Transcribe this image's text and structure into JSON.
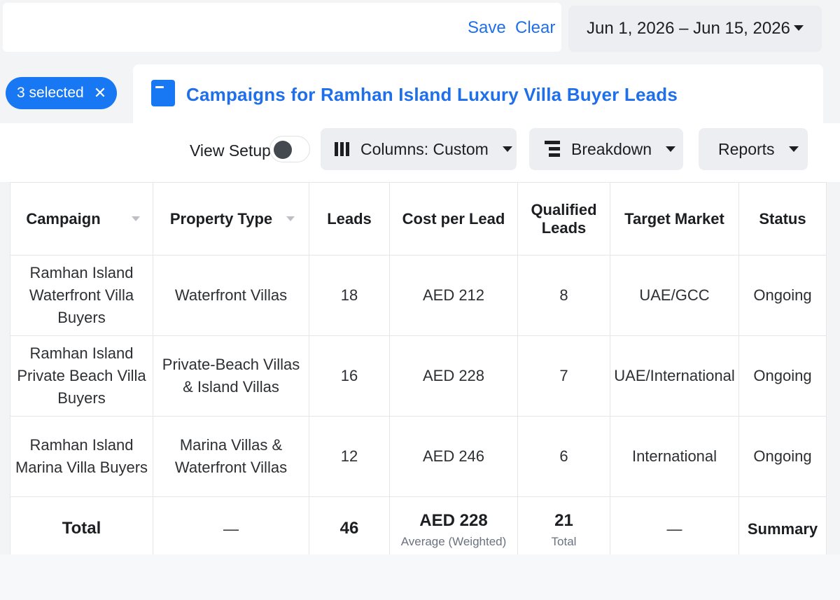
{
  "topbar": {
    "save_label": "Save",
    "clear_label": "Clear"
  },
  "date_range": {
    "label": "Jun 1, 2026 – Jun 15, 2026"
  },
  "selection": {
    "label": "3 selected",
    "clear_glyph": "✕"
  },
  "panel": {
    "title": "Campaigns for Ramhan Island Luxury Villa Buyer Leads",
    "icon": "campaign-icon"
  },
  "toolbar": {
    "view_setup_label": "View Setup",
    "view_setup_on": false,
    "columns_label": "Columns: Custom",
    "breakdown_label": "Breakdown",
    "reports_label": "Reports"
  },
  "table": {
    "headers": {
      "campaign": "Campaign",
      "property_type": "Property Type",
      "leads": "Leads",
      "cost_per_lead": "Cost per Lead",
      "qualified_leads_1": "Qualified",
      "qualified_leads_2": "Leads",
      "target_market": "Target Market",
      "status": "Status"
    },
    "rows": [
      {
        "campaign_1": "Ramhan Island",
        "campaign_2": "Waterfront Villa Buyers",
        "property_1": "Waterfront Villas",
        "property_2": "",
        "leads": "18",
        "cpl": "AED 212",
        "qualified": "8",
        "market": "UAE/GCC",
        "status": "Ongoing"
      },
      {
        "campaign_1": "Ramhan Island",
        "campaign_2": "Private Beach Villa Buyers",
        "property_1": "Private-Beach Villas",
        "property_2": "& Island Villas",
        "leads": "16",
        "cpl": "AED 228",
        "qualified": "7",
        "market": "UAE/International",
        "status": "Ongoing"
      },
      {
        "campaign_1": "Ramhan Island",
        "campaign_2": "Marina Villa Buyers",
        "property_1": "Marina Villas &",
        "property_2": "Waterfront Villas",
        "leads": "12",
        "cpl": "AED 246",
        "qualified": "6",
        "market": "International",
        "status": "Ongoing"
      }
    ],
    "total": {
      "label": "Total",
      "property": "—",
      "leads": "46",
      "cpl": "AED 228",
      "cpl_note": "Average (Weighted)",
      "qualified": "21",
      "qualified_note": "Total",
      "market": "—",
      "status": "Summary"
    }
  }
}
